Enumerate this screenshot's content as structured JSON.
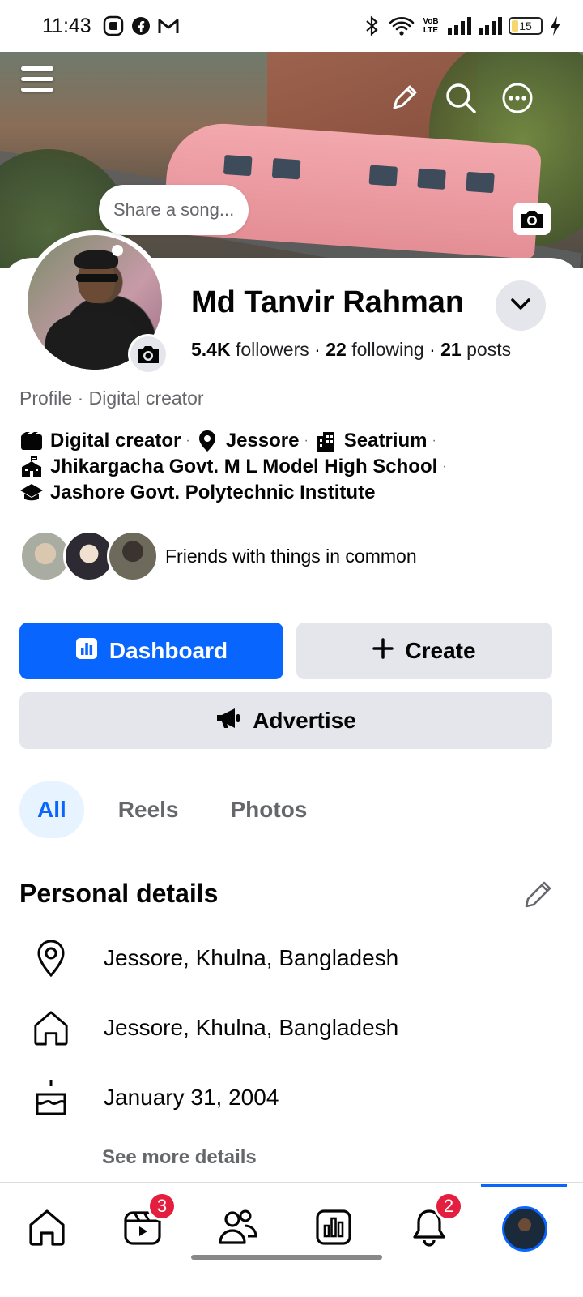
{
  "status_bar": {
    "time": "11:43",
    "left_icons": [
      "screen-record-icon",
      "facebook-icon",
      "gmail-icon"
    ],
    "right_icons": [
      "bluetooth-icon",
      "wifi-icon",
      "volte-icon",
      "signal-icon",
      "signal-icon"
    ],
    "volte_label": "VoB LTE",
    "battery": "15"
  },
  "cover": {
    "actions": [
      "menu-icon",
      "pencil-icon",
      "search-icon",
      "more-icon",
      "camera-icon"
    ]
  },
  "profile": {
    "share_prompt": "Share a song...",
    "name": "Md Tanvir Rahman",
    "followers_count": "5.4K",
    "followers_label": "followers",
    "following_count": "22",
    "following_label": "following",
    "posts_count": "21",
    "posts_label": "posts",
    "subtitle": "Profile · Digital creator",
    "intro": {
      "category": "Digital creator",
      "location": "Jessore",
      "work": "Seatrium",
      "school": "Jhikargacha Govt. M L Model High School",
      "college": "Jashore Govt. Polytechnic Institute",
      "separator": "·"
    },
    "mutual_text": "Friends with things in common"
  },
  "buttons": {
    "dashboard": "Dashboard",
    "create": "Create",
    "advertise": "Advertise"
  },
  "tabs": [
    {
      "label": "All",
      "active": true
    },
    {
      "label": "Reels",
      "active": false
    },
    {
      "label": "Photos",
      "active": false
    }
  ],
  "personal_details": {
    "title": "Personal details",
    "items": [
      {
        "icon": "location-pin-icon",
        "text": "Jessore, Khulna, Bangladesh"
      },
      {
        "icon": "home-icon",
        "text": "Jessore, Khulna, Bangladesh"
      },
      {
        "icon": "birthday-cake-icon",
        "text": "January 31, 2004"
      }
    ],
    "see_more": "See more details"
  },
  "bottom_nav": {
    "items": [
      "home-icon",
      "video-icon",
      "friends-icon",
      "dashboard-icon",
      "notifications-icon",
      "profile-avatar"
    ],
    "video_badge": "3",
    "notifications_badge": "2"
  },
  "colors": {
    "accent": "#0866ff",
    "badge": "#e41e3f",
    "secondary_button": "#e4e6eb",
    "muted_text": "#65676b"
  }
}
